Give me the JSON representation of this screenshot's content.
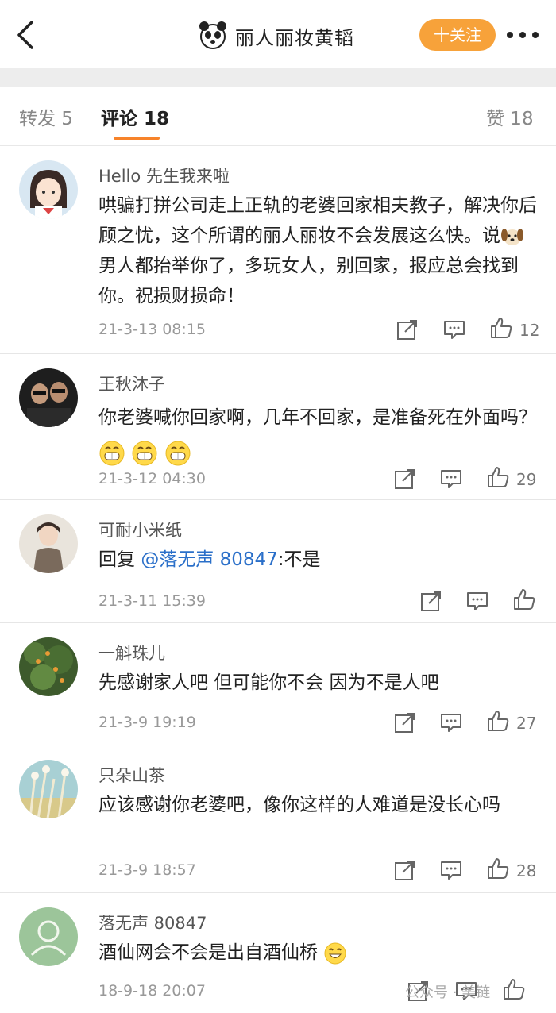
{
  "header": {
    "title": "丽人丽妆黄韬",
    "follow_label": "十关注"
  },
  "tabs": [
    {
      "label": "转发 5"
    },
    {
      "label": "评论 18"
    },
    {
      "label": "赞 18"
    }
  ],
  "comments": [
    {
      "name": "Hello 先生我来啦",
      "text_1": "哄骗打拼公司走上正轨的老婆回家相夫教子，解决你后顾之忧，这个所谓的丽人丽妆不会发展这么快。说",
      "text_2": "男人都抬举你了，多玩女人，别回家，报应总会找到你。祝损财损命！",
      "time": "21-3-13 08:15",
      "likes": "12"
    },
    {
      "name": "王秋沐子",
      "text_1": "你老婆喊你回家啊，几年不回家，是准备死在外面吗？",
      "time": "21-3-12 04:30",
      "likes": "29"
    },
    {
      "name": "可耐小米纸",
      "text_prefix": "回复",
      "mention": "@落无声 80847",
      "text_suffix": ":不是",
      "time": "21-3-11 15:39",
      "likes": ""
    },
    {
      "name": "一斛珠儿",
      "text_1": "先感谢家人吧 但可能你不会 因为不是人吧",
      "time": "21-3-9 19:19",
      "likes": "27"
    },
    {
      "name": "只朵山茶",
      "text_1": "应该感谢你老婆吧，像你这样的人难道是没长心吗",
      "time": "21-3-9 18:57",
      "likes": "28"
    },
    {
      "name": "落无声 80847",
      "text_1": "酒仙网会不会是出自酒仙桥",
      "time": "18-9-18 20:07",
      "likes": ""
    }
  ],
  "watermark": "公众号 · 美链",
  "colors": {
    "accent": "#f7a23a",
    "tab_underline": "#f7832a",
    "mention": "#2a6fc9"
  },
  "icons": [
    "back-arrow-icon",
    "panda-avatar-icon",
    "more-dots-icon",
    "share-icon",
    "comment-icon",
    "like-icon",
    "grin-emoji-icon",
    "dog-emoji-icon",
    "smile-emoji-icon"
  ]
}
